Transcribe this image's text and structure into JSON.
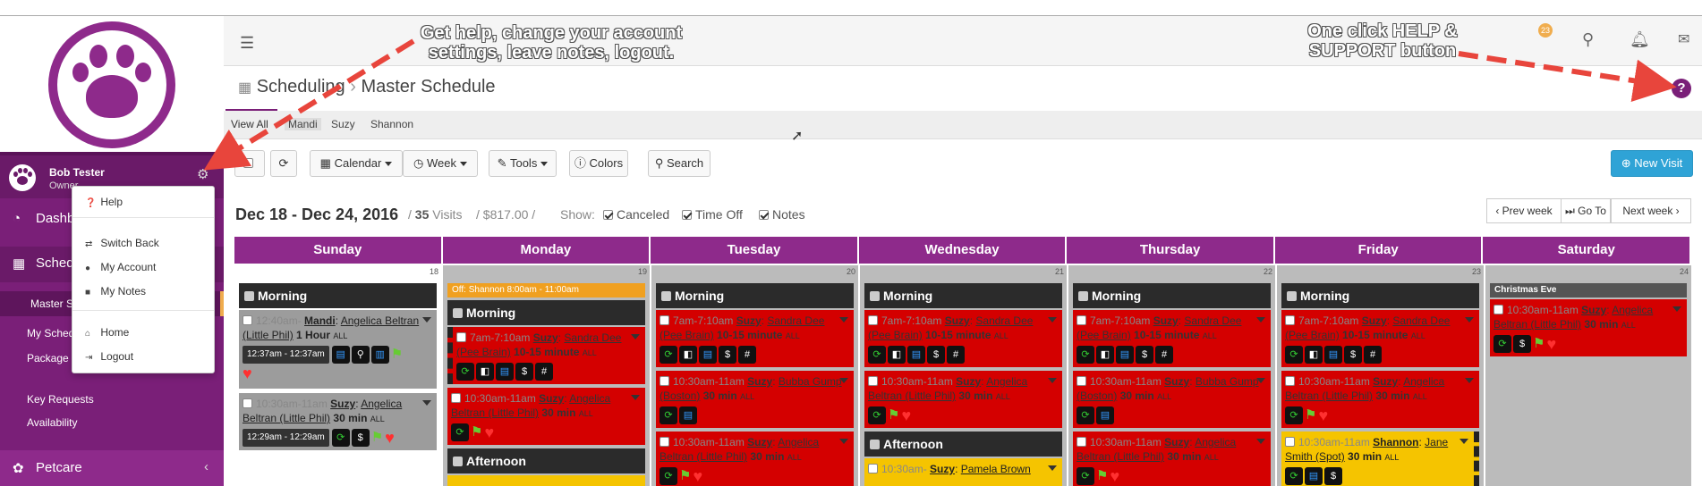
{
  "sidebar": {
    "user_name": "Bob Tester",
    "user_role": "Owner",
    "nav": [
      {
        "label": "Dashboard",
        "icon": "dashboard-icon"
      },
      {
        "label": "Schedule",
        "icon": "calendar-icon"
      },
      {
        "label": "Petcare",
        "icon": "paw-icon"
      }
    ],
    "sub": [
      "Master Schedule",
      "My Schedule",
      "Package",
      "Key Requests",
      "Availability"
    ],
    "dropdown": [
      "Help",
      "Switch Back",
      "My Account",
      "My Notes",
      "Home",
      "Logout"
    ]
  },
  "header": {
    "notification_count": "23"
  },
  "page": {
    "breadcrumb_root": "Scheduling",
    "breadcrumb_current": "Master Schedule"
  },
  "tabs": [
    "View All",
    "Mandi",
    "Suzy",
    "Shannon"
  ],
  "toolbar": {
    "calendar": "Calendar",
    "week": "Week",
    "tools": "Tools",
    "colors": "Colors",
    "search": "Search",
    "new_visit": "New Visit"
  },
  "summary": {
    "range": "Dec 18 - Dec 24, 2016",
    "visits_count": "35",
    "visits_label": "Visits",
    "amount": "$817.00",
    "show_label": "Show:",
    "canceled": "Canceled",
    "time_off": "Time Off",
    "notes": "Notes"
  },
  "pager": {
    "prev": "Prev week",
    "goto": "Go To",
    "next": "Next week"
  },
  "days": [
    "Sunday",
    "Monday",
    "Tuesday",
    "Wednesday",
    "Thursday",
    "Friday",
    "Saturday"
  ],
  "day_numbers": [
    "18",
    "19",
    "20",
    "21",
    "22",
    "23",
    "24"
  ],
  "calendar": {
    "morning": "Morning",
    "afternoon": "Afternoon",
    "time_off_banner": "Off: Shannon 8:00am - 11:00am",
    "holiday_banner": "Christmas Eve",
    "sun_v1": {
      "time": "12:40am-",
      "sitter": "Mandi",
      "client": "Angelica Beltran (Little Phil)",
      "duration": "1 Hour",
      "tag": "ALL",
      "pill": "12:37am - 12:37am"
    },
    "sun_v2": {
      "time": "10:30am-11am",
      "sitter": "Suzy",
      "client": "Angelica Beltran (Little Phil)",
      "duration": "30 min",
      "tag": "ALL",
      "pill": "12:29am - 12:29am"
    },
    "v_suzy_sandra": {
      "time": "7am-7:10am",
      "sitter": "Suzy",
      "client": "Sandra Dee (Pee Brain)",
      "duration": "10-15 minute",
      "tag": "ALL"
    },
    "v_suzy_angelica": {
      "time": "10:30am-11am",
      "sitter": "Suzy",
      "client": "Angelica Beltran (Little Phil)",
      "duration": "30 min",
      "tag": "ALL"
    },
    "v_suzy_bubba": {
      "time": "10:30am-11am",
      "sitter": "Suzy",
      "client": "Bubba Gump (Boston)",
      "duration": "30 min",
      "tag": "ALL"
    },
    "v_suzy_pamela": {
      "time": "10:30am-",
      "sitter": "Suzy",
      "client": "Pamela Brown",
      "tag": ""
    },
    "v_shannon_jane": {
      "time": "10:30am-11am",
      "sitter": "Shannon",
      "client": "Jane Smith (Spot)",
      "duration": "30 min",
      "tag": "ALL"
    },
    "v_sat": {
      "time": "10:30am-11am",
      "sitter": "Suzy",
      "client": "Angelica Beltran (Little Phil)",
      "duration": "30 min",
      "tag": "ALL"
    }
  },
  "annotations": {
    "left": "Get help, change your account settings, leave notes, logout.",
    "right": "One click HELP & SUPPORT button"
  }
}
